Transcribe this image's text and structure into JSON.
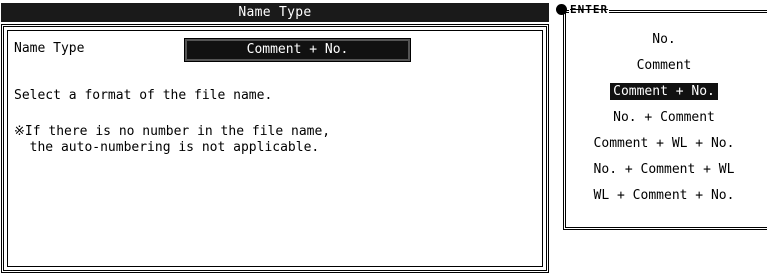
{
  "dialog": {
    "title": "Name Type",
    "field_label": "Name Type",
    "field_value": "Comment + No.",
    "message_1": "Select a format of the file name.",
    "message_2": "※If there is no number in the file name,",
    "message_3": "  the auto-numbering is not applicable."
  },
  "popup": {
    "header": "ENTER",
    "options": [
      {
        "label": "No.",
        "selected": false
      },
      {
        "label": "Comment",
        "selected": false
      },
      {
        "label": "Comment + No.",
        "selected": true
      },
      {
        "label": "No. + Comment",
        "selected": false
      },
      {
        "label": "Comment + WL + No.",
        "selected": false
      },
      {
        "label": "No. + Comment + WL",
        "selected": false
      },
      {
        "label": "WL + Comment + No.",
        "selected": false
      }
    ]
  }
}
